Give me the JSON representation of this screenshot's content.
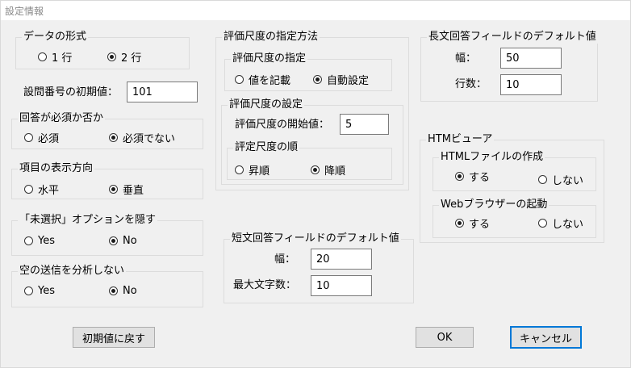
{
  "window": {
    "title": "設定情報"
  },
  "data_format": {
    "legend": "データの形式",
    "options": [
      "1 行",
      "2 行"
    ],
    "selected": 1
  },
  "question_number": {
    "label": "設問番号の初期値：",
    "value": "101"
  },
  "required": {
    "legend": "回答が必須か否か",
    "options": [
      "必須",
      "必須でない"
    ],
    "selected": 1
  },
  "direction": {
    "legend": "項目の表示方向",
    "options": [
      "水平",
      "垂直"
    ],
    "selected": 1
  },
  "hide_unselected": {
    "legend": "「未選択」オプションを隠す",
    "options": [
      "Yes",
      "No"
    ],
    "selected": 1
  },
  "empty_submit": {
    "legend": "空の送信を分析しない",
    "options": [
      "Yes",
      "No"
    ],
    "selected": 1
  },
  "scale": {
    "legend": "評価尺度の指定方法",
    "spec": {
      "legend": "評価尺度の指定",
      "options": [
        "値を記載",
        "自動設定"
      ],
      "selected": 1
    },
    "setting": {
      "legend": "評価尺度の設定",
      "start_label": "評価尺度の開始値：",
      "start_value": "5",
      "order": {
        "legend": "評定尺度の順",
        "options": [
          "昇順",
          "降順"
        ],
        "selected": 1
      }
    }
  },
  "short_answer": {
    "legend": "短文回答フィールドのデフォルト値",
    "width_label": "幅：",
    "width_value": "20",
    "max_label": "最大文字数：",
    "max_value": "10"
  },
  "long_answer": {
    "legend": "長文回答フィールドのデフォルト値",
    "width_label": "幅：",
    "width_value": "50",
    "rows_label": "行数：",
    "rows_value": "10"
  },
  "htm_viewer": {
    "legend": "HTMビューア",
    "create_html": {
      "legend": "HTMLファイルの作成",
      "options": [
        "する",
        "しない"
      ],
      "selected": 0
    },
    "launch_browser": {
      "legend": "Webブラウザーの起動",
      "options": [
        "する",
        "しない"
      ],
      "selected": 0
    }
  },
  "buttons": {
    "reset": "初期値に戻す",
    "ok": "OK",
    "cancel": "キャンセル"
  }
}
